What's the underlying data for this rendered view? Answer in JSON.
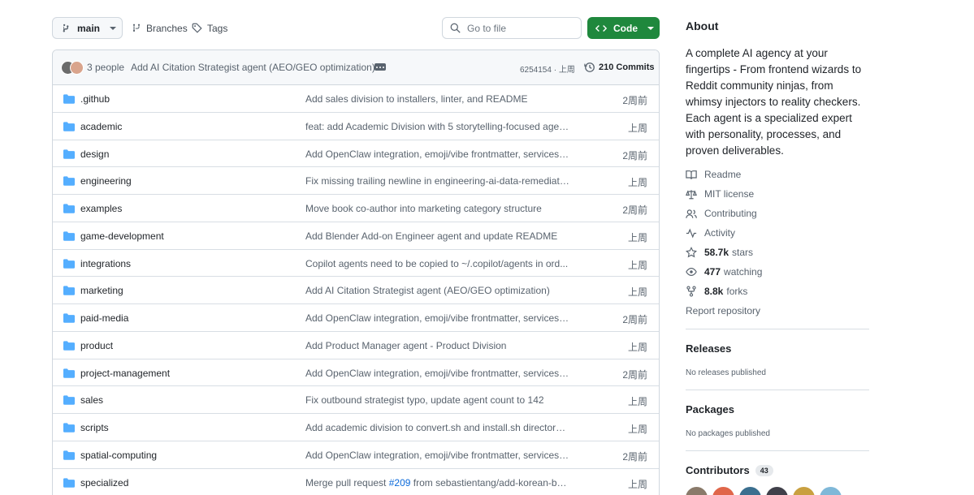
{
  "toolbar": {
    "branch": "main",
    "branches_label": "Branches",
    "tags_label": "Tags",
    "goto_placeholder": "Go to file",
    "code_label": "Code"
  },
  "commit_header": {
    "people": "3 people",
    "message": "Add AI Citation Strategist agent (AEO/GEO optimization)",
    "sha_time": "6254154 · 上周",
    "commits": "210 Commits"
  },
  "files": [
    {
      "name": ".github",
      "message": "Add sales division to installers, linter, and README",
      "time": "2周前"
    },
    {
      "name": "academic",
      "message": "feat: add Academic Division with 5 storytelling-focused agents",
      "time": "上周"
    },
    {
      "name": "design",
      "message": "Add OpenClaw integration, emoji/vibe frontmatter, services fi...",
      "time": "2周前"
    },
    {
      "name": "engineering",
      "message": "Fix missing trailing newline in engineering-ai-data-remediati...",
      "time": "上周"
    },
    {
      "name": "examples",
      "message": "Move book co-author into marketing category structure",
      "time": "2周前"
    },
    {
      "name": "game-development",
      "message": "Add Blender Add-on Engineer agent and update README",
      "time": "上周"
    },
    {
      "name": "integrations",
      "message": "Copilot agents need to be copied to ~/.copilot/agents in ord...",
      "time": "上周"
    },
    {
      "name": "marketing",
      "message": "Add AI Citation Strategist agent (AEO/GEO optimization)",
      "time": "上周"
    },
    {
      "name": "paid-media",
      "message": "Add OpenClaw integration, emoji/vibe frontmatter, services fi...",
      "time": "2周前"
    },
    {
      "name": "product",
      "message": "Add Product Manager agent - Product Division",
      "time": "上周"
    },
    {
      "name": "project-management",
      "message": "Add OpenClaw integration, emoji/vibe frontmatter, services fi...",
      "time": "2周前"
    },
    {
      "name": "sales",
      "message": "Fix outbound strategist typo, update agent count to 142",
      "time": "上周"
    },
    {
      "name": "scripts",
      "message": "Add academic division to convert.sh and install.sh directory l...",
      "time": "上周"
    },
    {
      "name": "spatial-computing",
      "message": "Add OpenClaw integration, emoji/vibe frontmatter, services fi...",
      "time": "2周前"
    },
    {
      "name": "specialized",
      "message_pre": "Merge pull request ",
      "pr": "#209",
      "message_post": " from sebastientang/add-korean-bu...",
      "time": "上周"
    }
  ],
  "about": {
    "title": "About",
    "description": "A complete AI agency at your fingertips - From frontend wizards to Reddit community ninjas, from whimsy injectors to reality checkers. Each agent is a specialized expert with personality, processes, and proven deliverables.",
    "readme": "Readme",
    "license": "MIT license",
    "contributing": "Contributing",
    "activity": "Activity",
    "stars_count": "58.7k",
    "stars_label": "stars",
    "watching_count": "477",
    "watching_label": "watching",
    "forks_count": "8.8k",
    "forks_label": "forks",
    "report": "Report repository"
  },
  "releases": {
    "title": "Releases",
    "sub": "No releases published"
  },
  "packages": {
    "title": "Packages",
    "sub": "No packages published"
  },
  "contributors": {
    "title": "Contributors",
    "count": "43"
  },
  "colors": {
    "accent_green": "#1f883d",
    "folder_blue": "#54aeff",
    "link_blue": "#0969da"
  }
}
